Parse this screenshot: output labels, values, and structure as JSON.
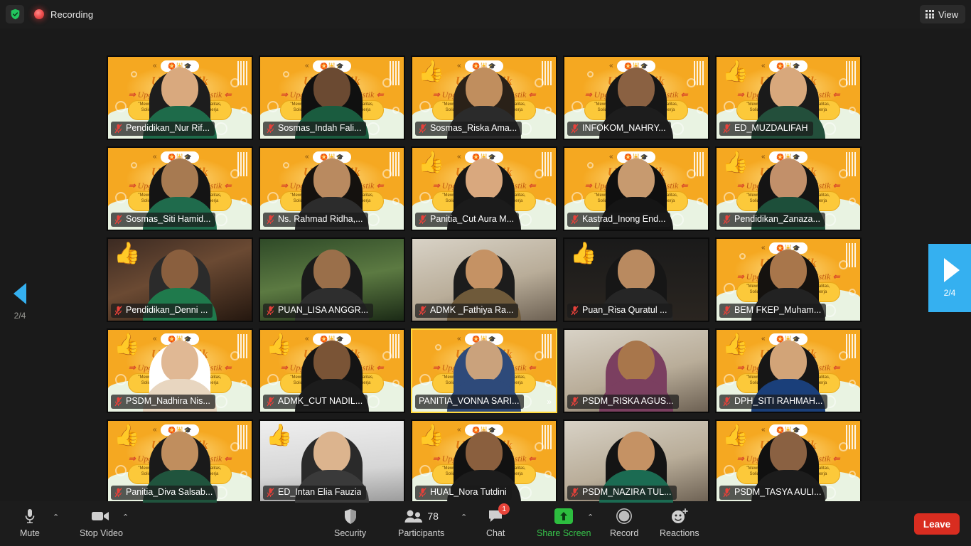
{
  "topbar": {
    "shield_icon": "shield-check-icon",
    "recording_label": "Recording",
    "recording_icon": "recording-dot-icon",
    "view_label": "View",
    "view_icon": "grid-icon"
  },
  "navigation": {
    "prev_icon": "triangle-left-icon",
    "prev_page": "2/4",
    "next_icon": "triangle-right-icon",
    "next_page": "2/4",
    "accent_color": "#35b0f0"
  },
  "virtual_background": {
    "title": "Up-StaTik",
    "subtitle": "Upgrading Staff Holistik",
    "tagline": "\"Mewujudkan kepengurusan yang Loyalitas, Solidaritas, Tanggung Jawab dan Kinerja Holistik\"",
    "primary_color": "#f5a821"
  },
  "grid": {
    "active_border_color": "#ffd83d",
    "mute_icon": "mic-muted-icon",
    "tiles": [
      {
        "name": "Pendidikan_Nur Rif...",
        "muted": true,
        "background": "banner",
        "reaction": "",
        "skin": "#d9a97e",
        "hijab": "#1d1d1d",
        "clothes": "#1e6b4a",
        "active": false
      },
      {
        "name": "Sosmas_Indah Fali...",
        "muted": true,
        "background": "banner",
        "reaction": "",
        "skin": "#6b4a32",
        "hijab": "#101010",
        "clothes": "#1a5c3f",
        "active": false
      },
      {
        "name": "Sosmas_Riska Ama...",
        "muted": true,
        "background": "banner",
        "reaction": "👍",
        "skin": "#c08e5e",
        "hijab": "#2a2118",
        "clothes": "#2b2b2b",
        "active": false
      },
      {
        "name": "INFOKOM_NAHRY...",
        "muted": true,
        "background": "banner",
        "reaction": "",
        "skin": "#8a6142",
        "hijab": "#161616",
        "clothes": "#1d1d1d",
        "active": false
      },
      {
        "name": "ED_MUZDALIFAH",
        "muted": true,
        "background": "banner",
        "reaction": "👍",
        "skin": "#d8a87c",
        "hijab": "#1a1a1a",
        "clothes": "#234f3b",
        "active": false
      },
      {
        "name": "Sosmas_Siti Hamid...",
        "muted": true,
        "background": "banner",
        "reaction": "",
        "skin": "#a77a51",
        "hijab": "#141414",
        "clothes": "#1f6b4c",
        "active": false
      },
      {
        "name": "Ns. Rahmad Ridha,...",
        "muted": true,
        "background": "banner",
        "reaction": "",
        "skin": "#b98a60",
        "hijab": "#14110e",
        "clothes": "#2c2c2c",
        "active": false
      },
      {
        "name": "Panitia_Cut Aura M...",
        "muted": true,
        "background": "banner",
        "reaction": "👍",
        "skin": "#d9a87e",
        "hijab": "#161616",
        "clothes": "#1b1b1b",
        "active": false
      },
      {
        "name": "Kastrad_Inong End...",
        "muted": true,
        "background": "banner",
        "reaction": "",
        "skin": "#c79a6f",
        "hijab": "#0f0f0f",
        "clothes": "#151515",
        "active": false
      },
      {
        "name": "Pendidikan_Zanaza...",
        "muted": true,
        "background": "banner",
        "reaction": "👍",
        "skin": "#c2906a",
        "hijab": "#141414",
        "clothes": "#1d4f3a",
        "active": false
      },
      {
        "name": "Pendidikan_Denni ...",
        "muted": true,
        "background": "room",
        "reaction": "👍",
        "skin": "#8a5f3e",
        "hijab": "#2b2b2b",
        "clothes": "#1f7a4c",
        "active": false
      },
      {
        "name": "PUAN_LISA ANGGR...",
        "muted": true,
        "background": "outdoor",
        "reaction": "",
        "skin": "#9a6f4a",
        "hijab": "#1a1a1a",
        "clothes": "#2e2e2e",
        "active": false
      },
      {
        "name": "ADMK _Fathiya Ra...",
        "muted": true,
        "background": "home",
        "reaction": "",
        "skin": "#c59264",
        "hijab": "#1c1c1c",
        "clothes": "#6f5a3a",
        "active": false
      },
      {
        "name": "Puan_Risa Quratul ...",
        "muted": true,
        "background": "dark",
        "reaction": "👍",
        "skin": "#b98a60",
        "hijab": "#161616",
        "clothes": "#262626",
        "active": false
      },
      {
        "name": "BEM FKEP_Muham...",
        "muted": true,
        "background": "banner",
        "reaction": "",
        "skin": "#a8764b",
        "hijab": "#15120f",
        "clothes": "#222222",
        "active": false
      },
      {
        "name": "PSDM_Nadhira Nis...",
        "muted": true,
        "background": "banner",
        "reaction": "👍",
        "skin": "#e0b894",
        "hijab": "#ffffff",
        "clothes": "#e8d6c0",
        "active": false
      },
      {
        "name": "ADMK_CUT NADIL...",
        "muted": true,
        "background": "banner",
        "reaction": "👍",
        "skin": "#7a5436",
        "hijab": "#141414",
        "clothes": "#1c1c1c",
        "active": false
      },
      {
        "name": "PANITIA_VONNA SARI...",
        "muted": false,
        "background": "banner",
        "reaction": "",
        "skin": "#caa27c",
        "hijab": "#2e4a7a",
        "clothes": "#2e4a7a",
        "active": true
      },
      {
        "name": "PSDM_RISKA AGUS...",
        "muted": true,
        "background": "home",
        "reaction": "",
        "skin": "#a8764b",
        "hijab": "#7b3f60",
        "clothes": "#7b3f60",
        "active": false
      },
      {
        "name": "DPH_SITI RAHMAH...",
        "muted": true,
        "background": "banner",
        "reaction": "👍",
        "skin": "#d2a478",
        "hijab": "#161616",
        "clothes": "#1a3f7a",
        "active": false
      },
      {
        "name": "Panitia_Diva Salsab...",
        "muted": true,
        "background": "banner",
        "reaction": "👍",
        "skin": "#c08e5e",
        "hijab": "#1a1a1a",
        "clothes": "#20543d",
        "active": false
      },
      {
        "name": "ED_Intan Elia Fauzia",
        "muted": true,
        "background": "plain",
        "reaction": "👍",
        "skin": "#dcb48e",
        "hijab": "#2a2a2a",
        "clothes": "#3a3a3a",
        "active": false
      },
      {
        "name": "HUAL_Nora Tutdini",
        "muted": true,
        "background": "banner",
        "reaction": "👍",
        "skin": "#8a5f3e",
        "hijab": "#111111",
        "clothes": "#1c1c1c",
        "active": false
      },
      {
        "name": "PSDM_NAZIRA TUL...",
        "muted": true,
        "background": "home",
        "reaction": "",
        "skin": "#c59264",
        "hijab": "#141414",
        "clothes": "#1b6b52",
        "active": false
      },
      {
        "name": "PSDM_TASYA AULI...",
        "muted": true,
        "background": "banner",
        "reaction": "👍",
        "skin": "#8a6142",
        "hijab": "#101010",
        "clothes": "#1c1c1c",
        "active": false
      }
    ]
  },
  "toolbar": {
    "mute": {
      "label": "Mute",
      "icon": "microphone-icon",
      "caret": "audio-options-caret"
    },
    "video": {
      "label": "Stop Video",
      "icon": "camera-icon",
      "caret": "video-options-caret"
    },
    "security": {
      "label": "Security",
      "icon": "shield-icon"
    },
    "participants": {
      "label": "Participants",
      "icon": "people-icon",
      "count": "78",
      "caret": "participants-caret"
    },
    "chat": {
      "label": "Chat",
      "icon": "chat-bubble-icon",
      "badge": "1"
    },
    "share": {
      "label": "Share Screen",
      "icon": "share-arrow-icon",
      "caret": "share-options-caret",
      "color": "#37c34a"
    },
    "record": {
      "label": "Record",
      "icon": "record-circle-icon"
    },
    "reactions": {
      "label": "Reactions",
      "icon": "smiley-plus-icon"
    },
    "leave": {
      "label": "Leave",
      "color": "#d92d20"
    }
  }
}
